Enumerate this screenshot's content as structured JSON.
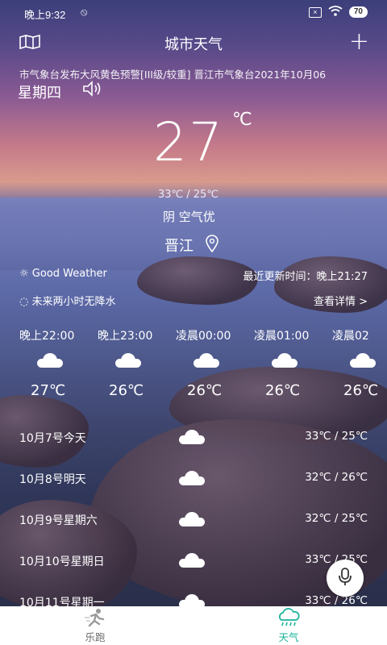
{
  "status_bar": {
    "time": "晚上9:32",
    "battery": "70"
  },
  "header": {
    "title": "城市天气"
  },
  "alert_ticker": "市气象台发布大风黄色预警[III级/较重]   晋江市气象台2021年10月06",
  "current": {
    "weekday": "星期四",
    "temperature": "27",
    "unit": "℃",
    "range": "33℃ / 25℃",
    "condition": "阴  空气优",
    "city": "晋江"
  },
  "info": {
    "good_weather": "Good Weather",
    "last_update": "最近更新时间：晚上21:27",
    "rain_forecast": "未来两小时无降水",
    "details_link": "查看详情 >"
  },
  "hourly": [
    {
      "time": "晚上22:00",
      "temp": "27℃"
    },
    {
      "time": "晚上23:00",
      "temp": "26℃"
    },
    {
      "time": "凌晨00:00",
      "temp": "26℃"
    },
    {
      "time": "凌晨01:00",
      "temp": "26℃"
    },
    {
      "time": "凌晨02",
      "temp": "26℃"
    }
  ],
  "daily": [
    {
      "date": "10月7号今天",
      "temps": "33℃ / 25℃"
    },
    {
      "date": "10月8号明天",
      "temps": "32℃ / 26℃"
    },
    {
      "date": "10月9号星期六",
      "temps": "32℃ / 25℃"
    },
    {
      "date": "10月10号星期日",
      "temps": "33℃ / 25℃"
    },
    {
      "date": "10月11号星期一",
      "temps": "33℃ / 26℃"
    }
  ],
  "tabs": {
    "running": "乐跑",
    "weather": "天气"
  },
  "colors": {
    "tab_active": "#19b39b",
    "tab_inactive": "#9a9a9a"
  }
}
